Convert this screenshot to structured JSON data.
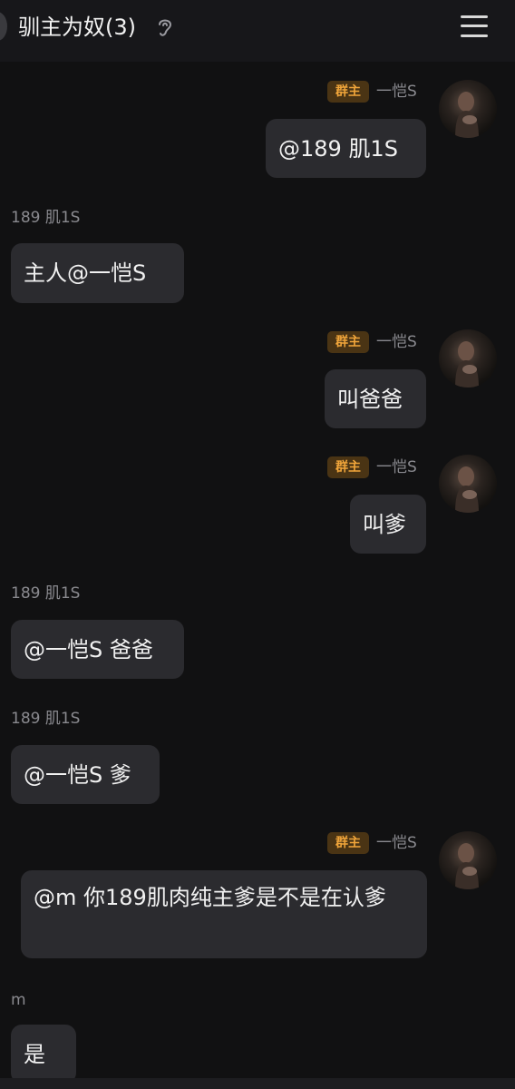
{
  "header": {
    "title": "驯主为奴(3)"
  },
  "owner_tag": "群主",
  "messages": [
    {
      "sender": "一恺S",
      "text": "@189 肌1S"
    },
    {
      "sender": "189 肌1S",
      "text": "主人@一恺S"
    },
    {
      "sender": "一恺S",
      "text": "叫爸爸"
    },
    {
      "sender": "一恺S",
      "text": "叫爹"
    },
    {
      "sender": "189 肌1S",
      "text": "@一恺S 爸爸"
    },
    {
      "sender": "189 肌1S",
      "text": "@一恺S 爹"
    },
    {
      "sender": "一恺S",
      "text": "@m 你189肌肉纯主爹是不是在认爹"
    },
    {
      "sender": "m",
      "text": "是"
    }
  ]
}
